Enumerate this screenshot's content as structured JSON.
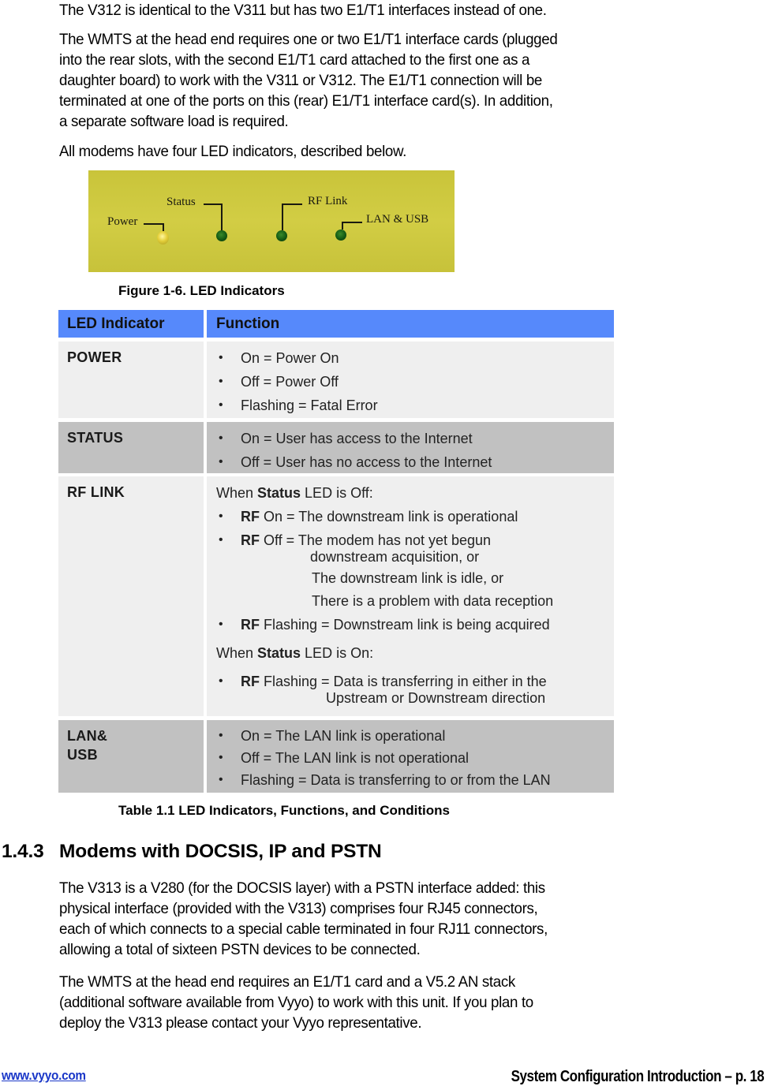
{
  "intro": {
    "p1": "The V312 is identical to the V311 but has two E1/T1 interfaces instead of one.",
    "p2_lines": [
      "The WMTS at the head end requires one or two E1/T1 interface cards (plugged",
      "into the rear slots, with the second E1/T1 card attached to the first one as a",
      "daughter board) to work with the V311 or V312.  The E1/T1 connection will be",
      "terminated at one of the ports on this (rear) E1/T1 interface card(s).  In addition,",
      "a separate software load is required."
    ],
    "p3": "All modems have four LED indicators, described below."
  },
  "figure": {
    "labels": {
      "power": "Power",
      "status": "Status",
      "rf_link": "RF Link",
      "lan_usb": "LAN & USB"
    },
    "led_colors": {
      "power": "#e4cf3a",
      "status": "#145a14",
      "rf_link": "#145a14",
      "lan_usb": "#145a14"
    },
    "panel_color": "#cfca40",
    "caption": "Figure 1-6. LED Indicators"
  },
  "table": {
    "header_color": "#5689fb",
    "headers": [
      "LED Indicator",
      "Function"
    ],
    "rows": [
      {
        "indicator": "POWER",
        "items": [
          "On = Power On",
          "Off = Power Off",
          "Flashing = Fatal Error"
        ]
      },
      {
        "indicator": "STATUS",
        "items": [
          "On = User has access to the Internet",
          "Off = User has no access to the Internet"
        ]
      },
      {
        "indicator": "RF LINK",
        "when_off_prefix": "When ",
        "when_off_bold": "Status",
        "when_off_suffix": " LED is Off:",
        "off_items": [
          {
            "bold": "RF",
            "text": " On = The downstream link is operational"
          },
          {
            "bold": "RF",
            "text": " Off = The modem has not yet begun",
            "continuation": [
              "downstream acquisition, or",
              "The downstream link is idle, or",
              "There is a problem with data reception"
            ]
          },
          {
            "bold": "RF",
            "text": " Flashing = Downstream link is being acquired"
          }
        ],
        "when_on_prefix": "When ",
        "when_on_bold": "Status",
        "when_on_suffix": " LED is On:",
        "on_items": [
          {
            "bold": "RF",
            "text": " Flashing = Data is transferring in either in the",
            "continuation": [
              "Upstream or Downstream direction"
            ]
          }
        ]
      },
      {
        "indicator_lines": [
          "LAN&",
          "USB"
        ],
        "items": [
          "On = The LAN link is operational",
          "Off = The LAN link is not operational",
          "Flashing = Data is transferring to or from the LAN"
        ]
      }
    ],
    "caption": "Table 1.1 LED Indicators, Functions, and Conditions"
  },
  "section": {
    "number": "1.4.3",
    "title": "Modems with DOCSIS, IP and PSTN",
    "p1_lines": [
      "The V313 is a V280 (for the DOCSIS layer) with a PSTN interface added: this",
      "physical interface (provided with the V313) comprises four RJ45 connectors,",
      "each of which connects to a special cable terminated in four RJ11 connectors,",
      "allowing a total of sixteen PSTN devices to be connected."
    ],
    "p2_lines": [
      "The WMTS at the head end requires an E1/T1 card and a V5.2 AN stack",
      "(additional software available from Vyyo) to work with this unit.  If you plan to",
      "deploy the V313 please contact your Vyyo representative."
    ]
  },
  "footer": {
    "link": "www.vyyo.com",
    "page_label": "System Configuration Introduction – p. 18"
  }
}
